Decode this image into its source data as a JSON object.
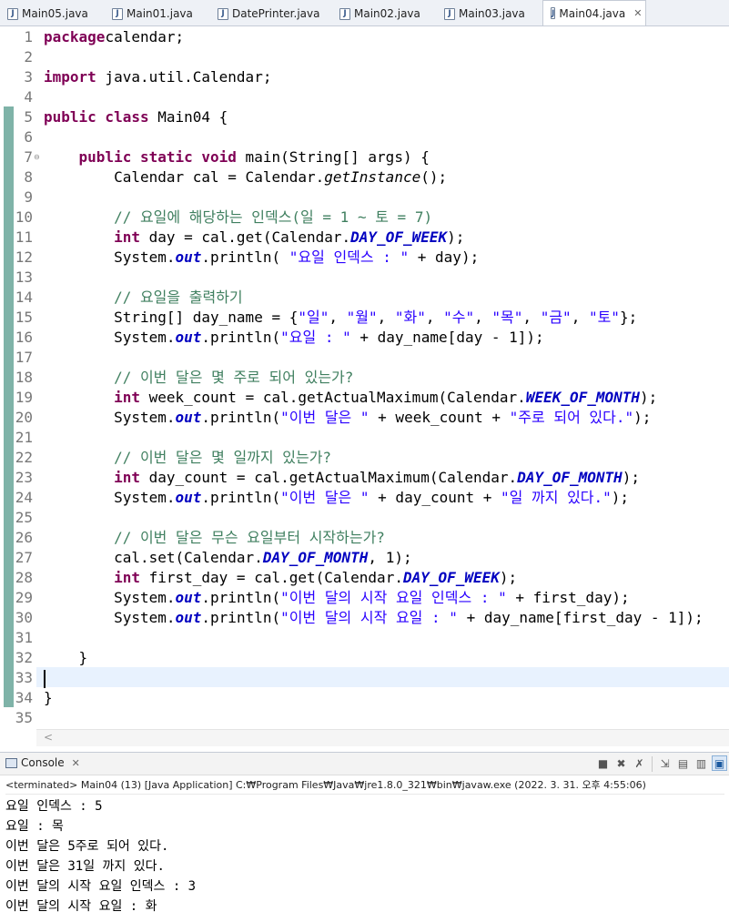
{
  "tabs": [
    {
      "label": "Main05.java",
      "active": false
    },
    {
      "label": "Main01.java",
      "active": false
    },
    {
      "label": "DatePrinter.java",
      "active": false
    },
    {
      "label": "Main02.java",
      "active": false
    },
    {
      "label": "Main03.java",
      "active": false
    },
    {
      "label": "Main04.java",
      "active": true
    }
  ],
  "editor": {
    "current_line": 33,
    "code": [
      {
        "n": "1",
        "segs": [
          [
            "kw",
            "package"
          ],
          [
            "",
            "calendar;"
          ]
        ]
      },
      {
        "n": "2",
        "segs": []
      },
      {
        "n": "3",
        "segs": [
          [
            "kw",
            "import"
          ],
          [
            "",
            " java.util.Calendar;"
          ]
        ]
      },
      {
        "n": "4",
        "segs": []
      },
      {
        "n": "5",
        "segs": [
          [
            "kw",
            "public class"
          ],
          [
            "",
            " Main04 {"
          ]
        ]
      },
      {
        "n": "6",
        "segs": []
      },
      {
        "n": "7",
        "fold": true,
        "segs": [
          [
            "",
            "    "
          ],
          [
            "kw",
            "public static void"
          ],
          [
            "",
            " main(String[] args) {"
          ]
        ]
      },
      {
        "n": "8",
        "segs": [
          [
            "",
            "        Calendar cal = Calendar."
          ],
          [
            "sm",
            "getInstance"
          ],
          [
            "",
            "();"
          ]
        ]
      },
      {
        "n": "9",
        "segs": []
      },
      {
        "n": "10",
        "segs": [
          [
            "",
            "        "
          ],
          [
            "cm",
            "// 요일에 해당하는 인덱스(일 = 1 ~ 토 = 7)"
          ]
        ]
      },
      {
        "n": "11",
        "segs": [
          [
            "",
            "        "
          ],
          [
            "kw",
            "int"
          ],
          [
            "",
            " day = cal.get(Calendar."
          ],
          [
            "fld",
            "DAY_OF_WEEK"
          ],
          [
            "",
            ");"
          ]
        ]
      },
      {
        "n": "12",
        "segs": [
          [
            "",
            "        System."
          ],
          [
            "fld",
            "out"
          ],
          [
            "",
            ".println( "
          ],
          [
            "str",
            "\"요일 인덱스 : \""
          ],
          [
            "",
            " + day);"
          ]
        ]
      },
      {
        "n": "13",
        "segs": []
      },
      {
        "n": "14",
        "segs": [
          [
            "",
            "        "
          ],
          [
            "cm",
            "// 요일을 출력하기"
          ]
        ]
      },
      {
        "n": "15",
        "segs": [
          [
            "",
            "        String[] day_name = {"
          ],
          [
            "str",
            "\"일\""
          ],
          [
            "",
            ", "
          ],
          [
            "str",
            "\"월\""
          ],
          [
            "",
            ", "
          ],
          [
            "str",
            "\"화\""
          ],
          [
            "",
            ", "
          ],
          [
            "str",
            "\"수\""
          ],
          [
            "",
            ", "
          ],
          [
            "str",
            "\"목\""
          ],
          [
            "",
            ", "
          ],
          [
            "str",
            "\"금\""
          ],
          [
            "",
            ", "
          ],
          [
            "str",
            "\"토\""
          ],
          [
            "",
            "};"
          ]
        ]
      },
      {
        "n": "16",
        "segs": [
          [
            "",
            "        System."
          ],
          [
            "fld",
            "out"
          ],
          [
            "",
            ".println("
          ],
          [
            "str",
            "\"요일 : \""
          ],
          [
            "",
            " + day_name[day - 1]);"
          ]
        ]
      },
      {
        "n": "17",
        "segs": []
      },
      {
        "n": "18",
        "segs": [
          [
            "",
            "        "
          ],
          [
            "cm",
            "// 이번 달은 몇 주로 되어 있는가?"
          ]
        ]
      },
      {
        "n": "19",
        "segs": [
          [
            "",
            "        "
          ],
          [
            "kw",
            "int"
          ],
          [
            "",
            " week_count = cal.getActualMaximum(Calendar."
          ],
          [
            "fld",
            "WEEK_OF_MONTH"
          ],
          [
            "",
            ");"
          ]
        ]
      },
      {
        "n": "20",
        "segs": [
          [
            "",
            "        System."
          ],
          [
            "fld",
            "out"
          ],
          [
            "",
            ".println("
          ],
          [
            "str",
            "\"이번 달은 \""
          ],
          [
            "",
            " + week_count + "
          ],
          [
            "str",
            "\"주로 되어 있다.\""
          ],
          [
            "",
            ");"
          ]
        ]
      },
      {
        "n": "21",
        "segs": []
      },
      {
        "n": "22",
        "segs": [
          [
            "",
            "        "
          ],
          [
            "cm",
            "// 이번 달은 몇 일까지 있는가?"
          ]
        ]
      },
      {
        "n": "23",
        "segs": [
          [
            "",
            "        "
          ],
          [
            "kw",
            "int"
          ],
          [
            "",
            " day_count = cal.getActualMaximum(Calendar."
          ],
          [
            "fld",
            "DAY_OF_MONTH"
          ],
          [
            "",
            ");"
          ]
        ]
      },
      {
        "n": "24",
        "segs": [
          [
            "",
            "        System."
          ],
          [
            "fld",
            "out"
          ],
          [
            "",
            ".println("
          ],
          [
            "str",
            "\"이번 달은 \""
          ],
          [
            "",
            " + day_count + "
          ],
          [
            "str",
            "\"일 까지 있다.\""
          ],
          [
            "",
            ");"
          ]
        ]
      },
      {
        "n": "25",
        "segs": []
      },
      {
        "n": "26",
        "segs": [
          [
            "",
            "        "
          ],
          [
            "cm",
            "// 이번 달은 무슨 요일부터 시작하는가?"
          ]
        ]
      },
      {
        "n": "27",
        "segs": [
          [
            "",
            "        cal.set(Calendar."
          ],
          [
            "fld",
            "DAY_OF_MONTH"
          ],
          [
            "",
            ", 1);"
          ]
        ]
      },
      {
        "n": "28",
        "segs": [
          [
            "",
            "        "
          ],
          [
            "kw",
            "int"
          ],
          [
            "",
            " first_day = cal.get(Calendar."
          ],
          [
            "fld",
            "DAY_OF_WEEK"
          ],
          [
            "",
            ");"
          ]
        ]
      },
      {
        "n": "29",
        "segs": [
          [
            "",
            "        System."
          ],
          [
            "fld",
            "out"
          ],
          [
            "",
            ".println("
          ],
          [
            "str",
            "\"이번 달의 시작 요일 인덱스 : \""
          ],
          [
            "",
            " + first_day);"
          ]
        ]
      },
      {
        "n": "30",
        "segs": [
          [
            "",
            "        System."
          ],
          [
            "fld",
            "out"
          ],
          [
            "",
            ".println("
          ],
          [
            "str",
            "\"이번 달의 시작 요일 : \""
          ],
          [
            "",
            " + day_name[first_day - 1]);"
          ]
        ]
      },
      {
        "n": "31",
        "segs": []
      },
      {
        "n": "32",
        "segs": [
          [
            "",
            "    }"
          ]
        ]
      },
      {
        "n": "33",
        "segs": []
      },
      {
        "n": "34",
        "segs": [
          [
            "",
            "}"
          ]
        ]
      },
      {
        "n": "35",
        "segs": []
      }
    ]
  },
  "console": {
    "tab_label": "Console",
    "status": "<terminated> Main04 (13) [Java Application] C:₩Program Files₩Java₩jre1.8.0_321₩bin₩javaw.exe (2022. 3. 31. 오후 4:55:06)",
    "output": [
      "요일 인덱스 : 5",
      "요일 : 목",
      "이번 달은 5주로 되어 있다.",
      "이번 달은 31일 까지 있다.",
      "이번 달의 시작 요일 인덱스 : 3",
      "이번 달의 시작 요일 : 화"
    ]
  },
  "icons": {
    "file": "java-file-icon",
    "tab_close": "close-icon",
    "console": "console-icon",
    "tools": [
      "terminate-icon",
      "remove-launch-icon",
      "remove-all-terminated-icon",
      "scroll-lock-icon",
      "show-when-stdout-icon",
      "show-when-stderr-icon",
      "pin-console-icon"
    ]
  },
  "glyphs": {
    "java_file": "J",
    "close": "✕",
    "fold": "⊖",
    "scroll_left": "<"
  }
}
